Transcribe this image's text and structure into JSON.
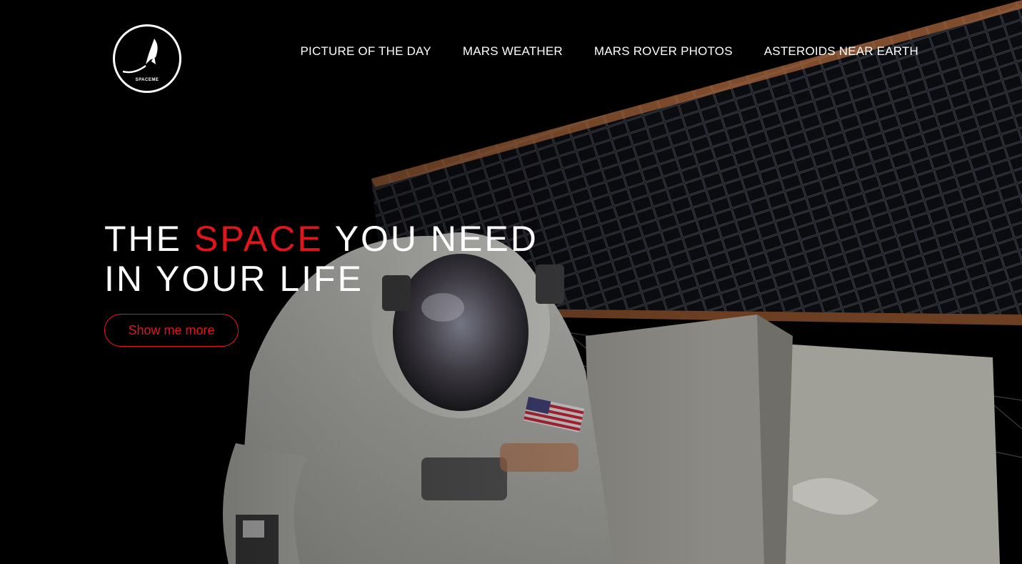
{
  "brand": {
    "logo_text": "SPACEME"
  },
  "nav": {
    "items": [
      {
        "label": "PICTURE OF THE DAY"
      },
      {
        "label": "MARS WEATHER"
      },
      {
        "label": "MARS ROVER PHOTOS"
      },
      {
        "label": "ASTEROIDS NEAR EARTH"
      }
    ]
  },
  "hero": {
    "headline_part1": "THE ",
    "headline_accent": "SPACE",
    "headline_part2": " YOU NEED",
    "headline_line2": "IN YOUR LIFE",
    "cta_label": "Show me more"
  },
  "colors": {
    "background": "#000000",
    "accent": "#e0161d",
    "text": "#ffffff"
  }
}
